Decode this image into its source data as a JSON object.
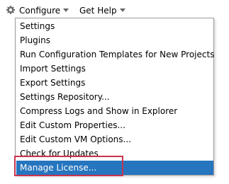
{
  "toolbar": {
    "configure_label": "Configure",
    "get_help_label": "Get Help",
    "icons": {
      "configure": "gear-icon",
      "dropdown": "chevron-down-icon"
    }
  },
  "menu": {
    "items": [
      {
        "label": "Settings"
      },
      {
        "label": "Plugins"
      },
      {
        "label": "Run Configuration Templates for New Projects"
      },
      {
        "label": "Import Settings"
      },
      {
        "label": "Export Settings"
      },
      {
        "label": "Settings Repository..."
      },
      {
        "label": "Compress Logs and Show in Explorer"
      },
      {
        "label": "Edit Custom Properties..."
      },
      {
        "label": "Edit Custom VM Options..."
      },
      {
        "label": "Check for Updates"
      },
      {
        "label": "Manage License...",
        "selected": true
      }
    ]
  },
  "colors": {
    "selection": "#2675bf",
    "annotation_box": "#c8344e",
    "menu_border": "#9a9a9a"
  }
}
